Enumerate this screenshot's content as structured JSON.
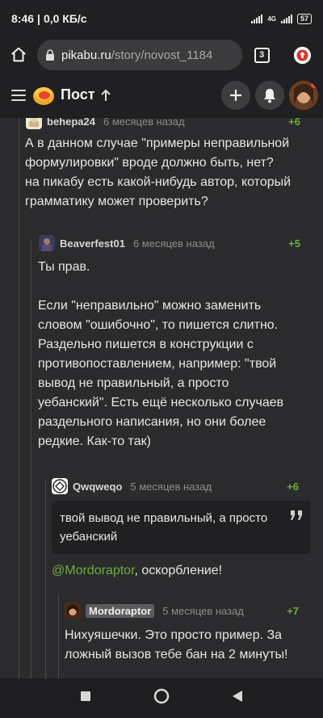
{
  "status": {
    "time": "8:46",
    "speed": "0,0 КБ/с",
    "network": "4G",
    "battery": "57"
  },
  "browser": {
    "url_domain": "pikabu.ru",
    "url_path": "/story/novost_1184",
    "tab_count": "3"
  },
  "header": {
    "title": "Пост"
  },
  "comments": [
    {
      "author": "behepa24",
      "date": "6 месяцев назад",
      "rating": "+6",
      "text": "А в данном случае \"примеры неправильной формулировки\" вроде должно быть, нет?\nна пикабу есть какой-нибудь автор, который грамматику может проверить?"
    },
    {
      "author": "Beaverfest01",
      "date": "6 месяцев назад",
      "rating": "+5",
      "text": "Ты прав.\n\nЕсли \"неправильно\" можно заменить словом \"ошибочно\", то пишется слитно. Раздельно пишется в конструкции с противопоставлением, например: \"твой вывод не правильный, а просто уебанский\". Есть ещё несколько случаев раздельного написания, но они более редкие. Как-то так)"
    },
    {
      "author": "Qwqweqo",
      "date": "5 месяцев назад",
      "rating": "+6",
      "quote": "твой вывод не правильный, а просто уебанский",
      "mention": "@Mordoraptor",
      "text_after": ", оскорбление!"
    },
    {
      "author": "Mordoraptor",
      "date": "5 месяцев назад",
      "rating": "+7",
      "text": "Нихуяшечки. Это просто пример. За ложный вызов тебе бан на 2 минуты!"
    }
  ]
}
